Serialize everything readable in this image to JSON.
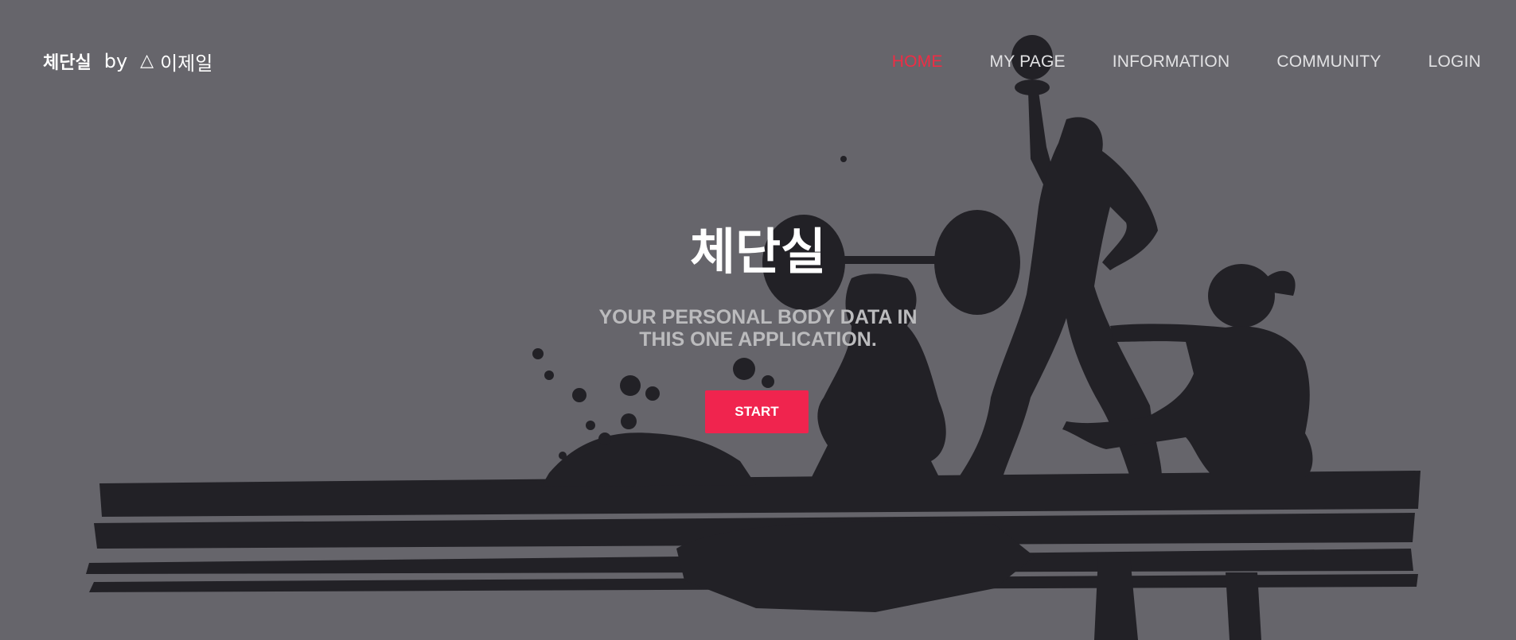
{
  "brand": {
    "name": "체단실",
    "by": "by",
    "author_icon": "triangle-icon",
    "author": "이제일"
  },
  "nav": {
    "items": [
      {
        "label": "HOME",
        "active": true
      },
      {
        "label": "MY PAGE",
        "active": false
      },
      {
        "label": "INFORMATION",
        "active": false
      },
      {
        "label": "COMMUNITY",
        "active": false
      },
      {
        "label": "LOGIN",
        "active": false
      }
    ]
  },
  "hero": {
    "title": "체단실",
    "subtitle": "YOUR PERSONAL BODY DATA IN THIS ONE APPLICATION.",
    "cta": "START"
  },
  "colors": {
    "background": "#66656b",
    "silhouette": "#222126",
    "accent": "#f0244e",
    "nav_active": "#ee2d45",
    "nav_text": "#e2e2e4"
  }
}
